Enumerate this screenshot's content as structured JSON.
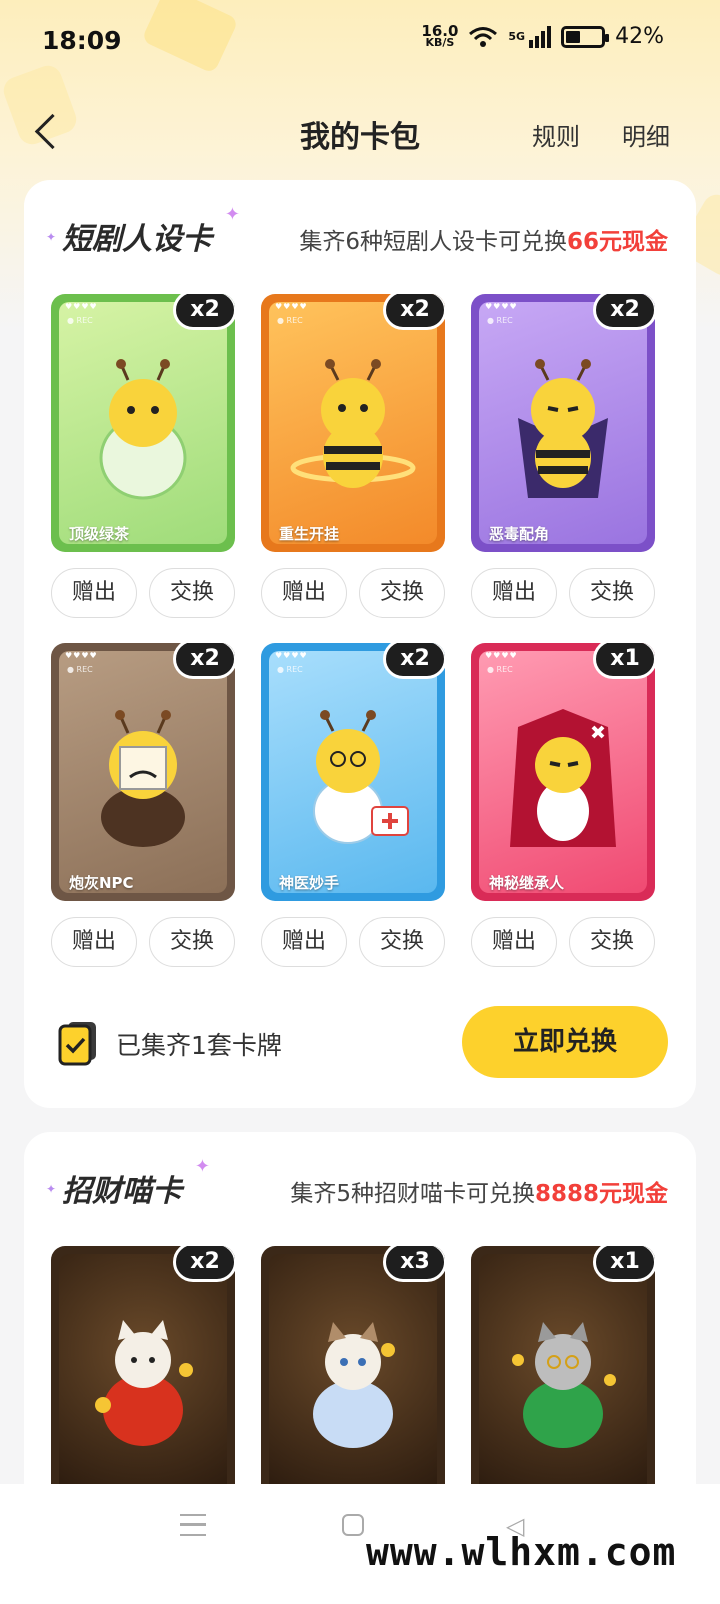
{
  "status": {
    "time": "18:09",
    "net_speed_value": "16.0",
    "net_speed_unit": "KB/S",
    "signal_label": "5G",
    "battery": "42%"
  },
  "header": {
    "title": "我的卡包",
    "rules": "规则",
    "details": "明细"
  },
  "section1": {
    "title": "短剧人设卡",
    "desc_prefix": "集齐6种短剧人设卡可兑换",
    "desc_highlight": "66元现金",
    "cards": [
      {
        "name": "顶级绿茶",
        "count": "x2",
        "color": "#86d46a"
      },
      {
        "name": "重生开挂",
        "count": "x2",
        "color": "#f3902a"
      },
      {
        "name": "恶毒配角",
        "count": "x2",
        "color": "#8f66d8"
      },
      {
        "name": "炮灰NPC",
        "count": "x2",
        "color": "#8b6f5c"
      },
      {
        "name": "神医妙手",
        "count": "x2",
        "color": "#4fb3ec"
      },
      {
        "name": "神秘继承人",
        "count": "x1",
        "color": "#ec3f6a"
      }
    ],
    "gift_label": "赠出",
    "exchange_label": "交换",
    "collected_text": "已集齐1套卡牌",
    "redeem_label": "立即兑换"
  },
  "section2": {
    "title": "招财喵卡",
    "desc_prefix": "集齐5种招财喵卡可兑换",
    "desc_highlight": "8888元现金",
    "cards": [
      {
        "count": "x2",
        "color": "#4a3422"
      },
      {
        "count": "x3",
        "color": "#4a3422"
      },
      {
        "count": "x1",
        "color": "#4a3422"
      }
    ]
  },
  "watermark": "www.wlhxm.com"
}
